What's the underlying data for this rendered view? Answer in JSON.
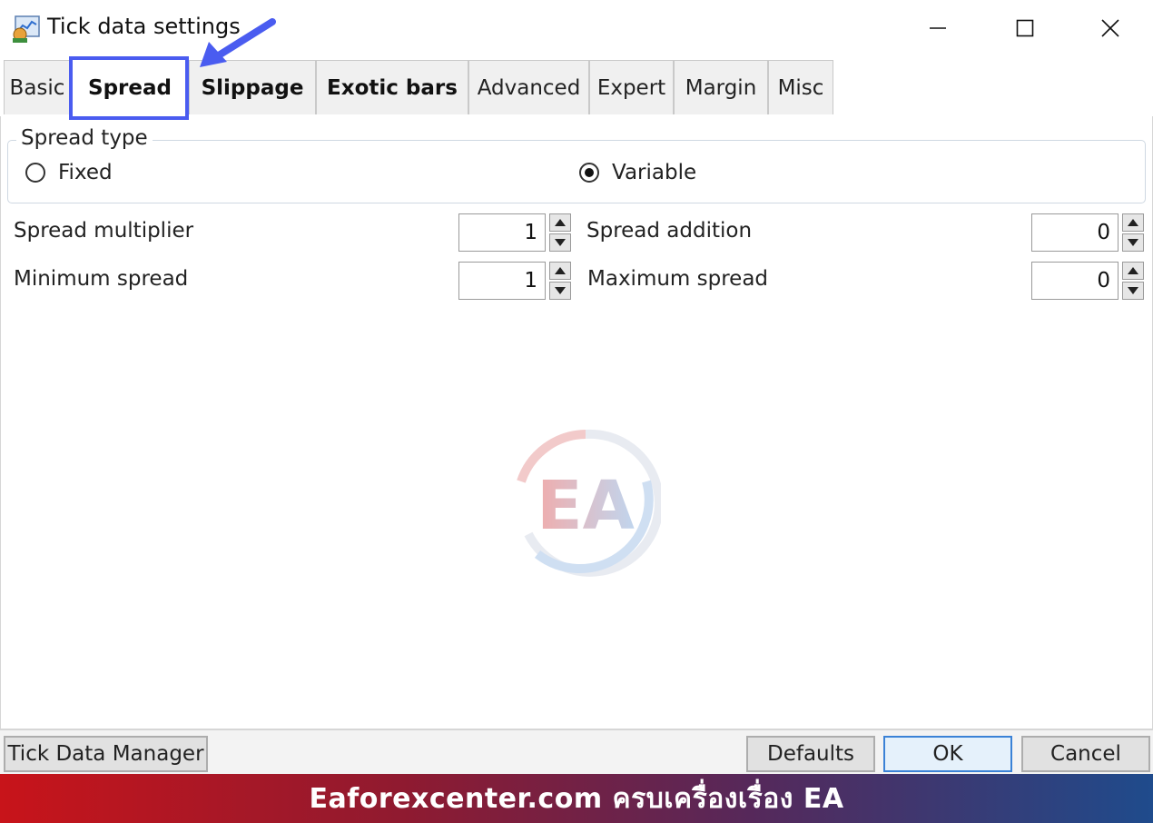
{
  "window": {
    "title": "Tick data settings",
    "icon": "tick-data-app-icon",
    "controls": [
      "minimize-icon",
      "maximize-icon",
      "close-icon"
    ]
  },
  "tabs": [
    {
      "label": "Basic",
      "active": false
    },
    {
      "label": "Spread",
      "active": true
    },
    {
      "label": "Slippage",
      "active": false
    },
    {
      "label": "Exotic bars",
      "active": false
    },
    {
      "label": "Advanced",
      "active": false
    },
    {
      "label": "Expert",
      "active": false
    },
    {
      "label": "Margin",
      "active": false
    },
    {
      "label": "Misc",
      "active": false
    }
  ],
  "spread_type": {
    "legend": "Spread type",
    "options": [
      {
        "label": "Fixed",
        "selected": false
      },
      {
        "label": "Variable",
        "selected": true
      }
    ]
  },
  "fields": {
    "spread_multiplier": {
      "label": "Spread multiplier",
      "value": "1"
    },
    "spread_addition": {
      "label": "Spread addition",
      "value": "0"
    },
    "minimum_spread": {
      "label": "Minimum spread",
      "value": "1"
    },
    "maximum_spread": {
      "label": "Maximum spread",
      "value": "0"
    }
  },
  "buttons": {
    "tick_data_manager": "Tick Data Manager",
    "defaults": "Defaults",
    "ok": "OK",
    "cancel": "Cancel"
  },
  "watermark": {
    "text": "EA"
  },
  "banner": {
    "text": "Eaforexcenter.com ครบเครื่องเรื่อง EA"
  },
  "colors": {
    "highlight": "#4a5cf0",
    "banner_start": "#c8141a",
    "banner_end": "#1f4b8c"
  }
}
